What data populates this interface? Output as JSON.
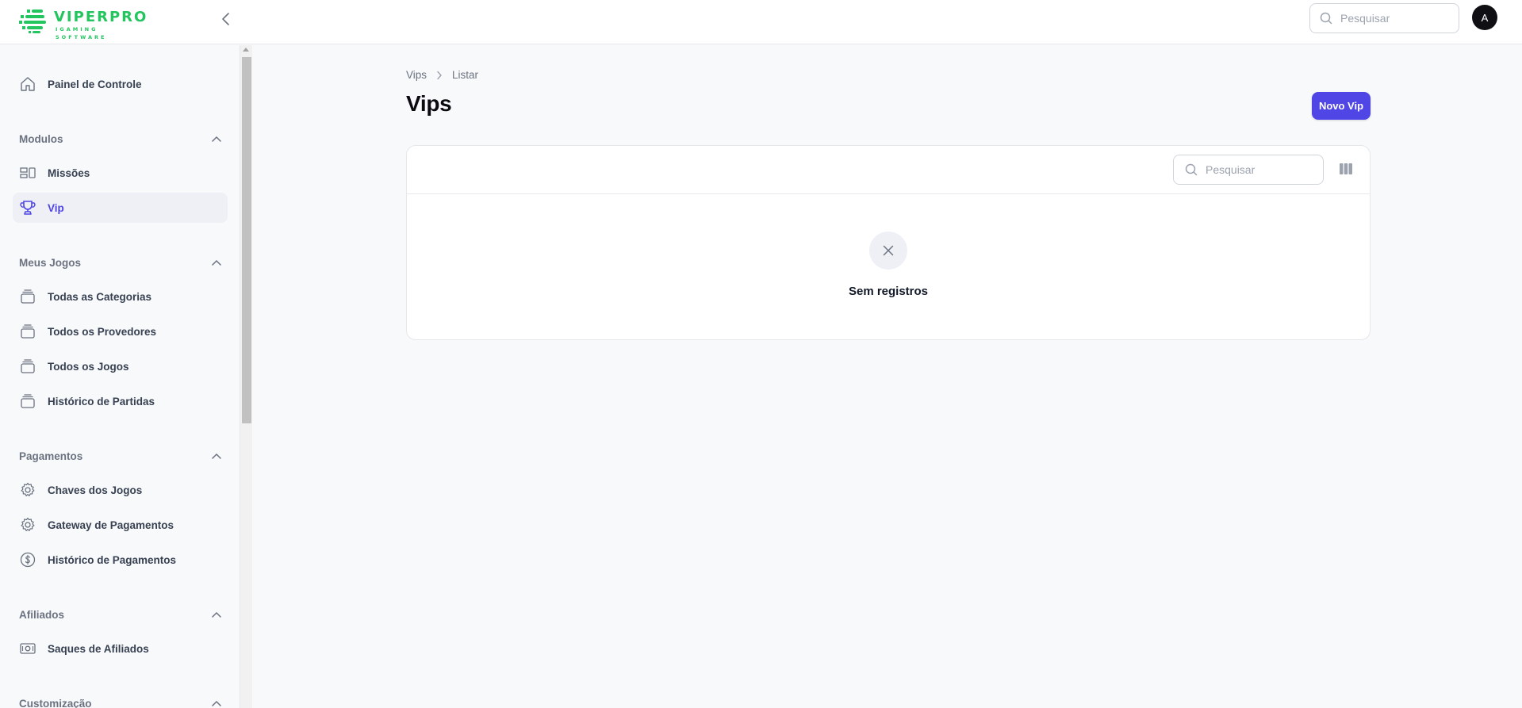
{
  "brand": {
    "name": "VIPERPRO",
    "tagline": "IGAMING SOFTWARE",
    "color": "#22c55e"
  },
  "header": {
    "search_placeholder": "Pesquisar",
    "avatar_initial": "A",
    "collapse_icon": "chevron-left-icon"
  },
  "sidebar": {
    "dashboard": {
      "label": "Painel de Controle",
      "icon": "home-icon"
    },
    "groups": [
      {
        "label": "Modulos",
        "items": [
          {
            "label": "Missões",
            "icon": "layout-icon"
          },
          {
            "label": "Vip",
            "icon": "trophy-icon",
            "active": true
          }
        ]
      },
      {
        "label": "Meus Jogos",
        "items": [
          {
            "label": "Todas as Categorias",
            "icon": "stack-icon"
          },
          {
            "label": "Todos os Provedores",
            "icon": "stack-icon"
          },
          {
            "label": "Todos os Jogos",
            "icon": "stack-icon"
          },
          {
            "label": "Histórico de Partidas",
            "icon": "stack-icon"
          }
        ]
      },
      {
        "label": "Pagamentos",
        "items": [
          {
            "label": "Chaves dos Jogos",
            "icon": "gear-icon"
          },
          {
            "label": "Gateway de Pagamentos",
            "icon": "gear-icon"
          },
          {
            "label": "Histórico de Pagamentos",
            "icon": "dollar-icon"
          }
        ]
      },
      {
        "label": "Afiliados",
        "items": [
          {
            "label": "Saques de Afiliados",
            "icon": "cash-icon"
          }
        ]
      },
      {
        "label": "Customização",
        "items": []
      }
    ]
  },
  "main": {
    "breadcrumb": [
      "Vips",
      "Listar"
    ],
    "title": "Vips",
    "new_button": "Novo Vip",
    "table": {
      "search_placeholder": "Pesquisar",
      "empty_text": "Sem registros"
    }
  },
  "colors": {
    "accent": "#4f46e5",
    "background": "#f8f9fb"
  }
}
